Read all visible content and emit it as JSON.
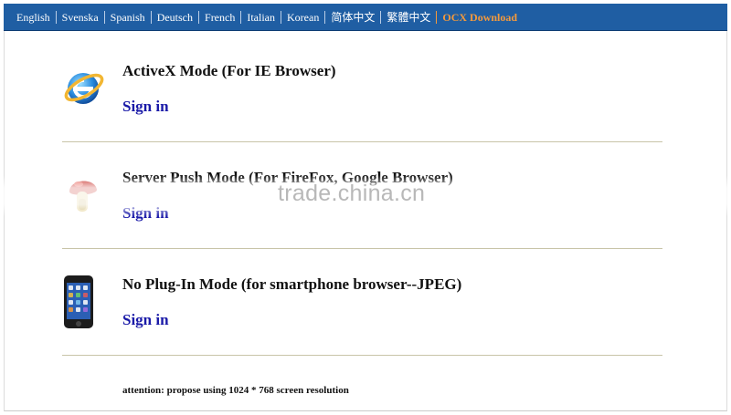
{
  "nav": {
    "items": [
      "English",
      "Svenska",
      "Spanish",
      "Deutsch",
      "French",
      "Italian",
      "Korean",
      "简体中文",
      "繁體中文"
    ],
    "ocx_download": "OCX Download"
  },
  "modes": [
    {
      "title": "ActiveX Mode (For IE Browser)",
      "sign_in": "Sign in",
      "icon": "ie-browser-icon"
    },
    {
      "title": "Server Push Mode (For FireFox, Google Browser)",
      "sign_in": "Sign in",
      "icon": "red-mushroom-icon"
    },
    {
      "title": "No Plug-In Mode (for smartphone browser--JPEG)",
      "sign_in": "Sign in",
      "icon": "smartphone-icon"
    }
  ],
  "attention": "attention: propose using 1024 * 768 screen resolution",
  "watermark": "trade.china.cn",
  "colors": {
    "topbar": "#1f5ea3",
    "ocx_link": "#f59a3c",
    "sign_in_link": "#1a1aa8",
    "divider": "#c8c4a8"
  }
}
